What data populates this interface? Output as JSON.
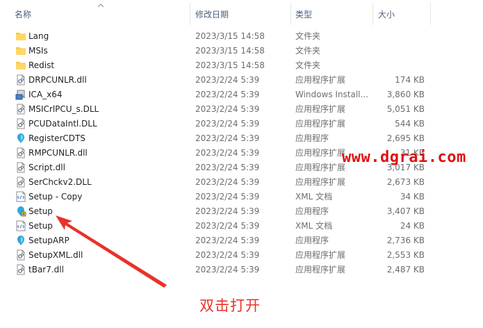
{
  "columns": {
    "name": "名称",
    "date": "修改日期",
    "type": "类型",
    "size": "大小"
  },
  "files": [
    {
      "name": "Lang",
      "date": "2023/3/15 14:58",
      "type": "文件夹",
      "size": "",
      "icon": "folder-icon"
    },
    {
      "name": "MSIs",
      "date": "2023/3/15 14:58",
      "type": "文件夹",
      "size": "",
      "icon": "folder-icon"
    },
    {
      "name": "Redist",
      "date": "2023/3/15 14:58",
      "type": "文件夹",
      "size": "",
      "icon": "folder-icon"
    },
    {
      "name": "DRPCUNLR.dll",
      "date": "2023/2/24 5:39",
      "type": "应用程序扩展",
      "size": "174 KB",
      "icon": "dll-icon"
    },
    {
      "name": "ICA_x64",
      "date": "2023/2/24 5:39",
      "type": "Windows Install...",
      "size": "3,860 KB",
      "icon": "installer-icon"
    },
    {
      "name": "MSICrlPCU_s.DLL",
      "date": "2023/2/24 5:39",
      "type": "应用程序扩展",
      "size": "5,051 KB",
      "icon": "dll-icon"
    },
    {
      "name": "PCUDataIntl.DLL",
      "date": "2023/2/24 5:39",
      "type": "应用程序扩展",
      "size": "544 KB",
      "icon": "dll-icon"
    },
    {
      "name": "RegisterCDTS",
      "date": "2023/2/24 5:39",
      "type": "应用程序",
      "size": "2,695 KB",
      "icon": "app-icon"
    },
    {
      "name": "RMPCUNLR.dll",
      "date": "2023/2/24 5:39",
      "type": "应用程序扩展",
      "size": "31 KB",
      "icon": "dll-icon"
    },
    {
      "name": "Script.dll",
      "date": "2023/2/24 5:39",
      "type": "应用程序扩展",
      "size": "3,017 KB",
      "icon": "dll-icon"
    },
    {
      "name": "SerChckv2.DLL",
      "date": "2023/2/24 5:39",
      "type": "应用程序扩展",
      "size": "2,673 KB",
      "icon": "dll-icon"
    },
    {
      "name": "Setup - Copy",
      "date": "2023/2/24 5:39",
      "type": "XML 文档",
      "size": "34 KB",
      "icon": "xml-icon"
    },
    {
      "name": "Setup",
      "date": "2023/2/24 5:39",
      "type": "应用程序",
      "size": "3,407 KB",
      "icon": "setup-app-icon"
    },
    {
      "name": "Setup",
      "date": "2023/2/24 5:39",
      "type": "XML 文档",
      "size": "24 KB",
      "icon": "xml-icon"
    },
    {
      "name": "SetupARP",
      "date": "2023/2/24 5:39",
      "type": "应用程序",
      "size": "2,736 KB",
      "icon": "app-icon"
    },
    {
      "name": "SetupXML.dll",
      "date": "2023/2/24 5:39",
      "type": "应用程序扩展",
      "size": "2,553 KB",
      "icon": "dll-icon"
    },
    {
      "name": "tBar7.dll",
      "date": "2023/2/24 5:39",
      "type": "应用程序扩展",
      "size": "2,487 KB",
      "icon": "dll-icon"
    }
  ],
  "watermark": "www.dgrai.com",
  "annotation": "双击打开",
  "colors": {
    "accent": "#e8322a",
    "watermark": "#e01010",
    "folder": "#f8c94a"
  }
}
